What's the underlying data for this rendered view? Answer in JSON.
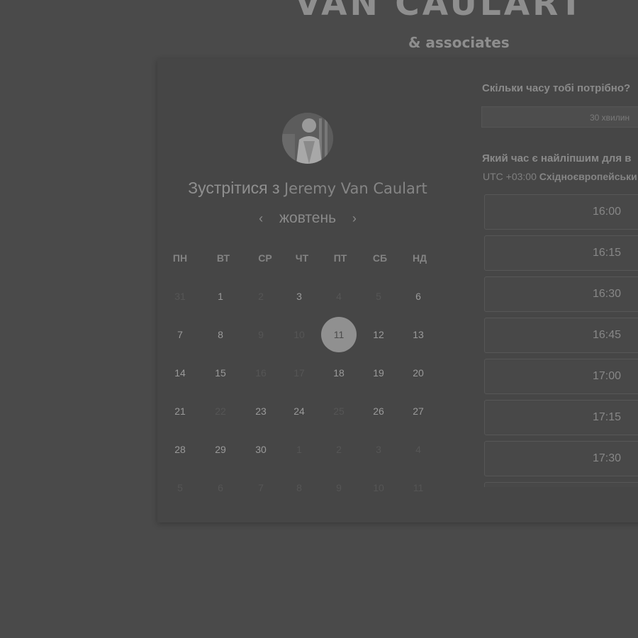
{
  "brand": {
    "name": "VAN CAULART",
    "subtitle": "& associates"
  },
  "host": {
    "avatar_icon": "person-avatar",
    "title_prefix": "Зустрітися з",
    "name": "Jeremy Van Caulart"
  },
  "calendar": {
    "month": "жовтень",
    "prev_icon": "chevron-left-icon",
    "next_icon": "chevron-right-icon",
    "weekdays": [
      "ПН",
      "ВТ",
      "СР",
      "ЧТ",
      "ПТ",
      "СБ",
      "НД"
    ],
    "selected_day": "11",
    "weeks": [
      [
        {
          "d": "31",
          "s": "muted"
        },
        {
          "d": "1",
          "s": "active"
        },
        {
          "d": "2",
          "s": "muted"
        },
        {
          "d": "3",
          "s": "active"
        },
        {
          "d": "4",
          "s": "muted"
        },
        {
          "d": "5",
          "s": "muted"
        },
        {
          "d": "6",
          "s": "active"
        }
      ],
      [
        {
          "d": "7",
          "s": "active"
        },
        {
          "d": "8",
          "s": "active"
        },
        {
          "d": "9",
          "s": "muted"
        },
        {
          "d": "10",
          "s": "muted"
        },
        {
          "d": "11",
          "s": "selected"
        },
        {
          "d": "12",
          "s": "active"
        },
        {
          "d": "13",
          "s": "active"
        }
      ],
      [
        {
          "d": "14",
          "s": "active"
        },
        {
          "d": "15",
          "s": "active"
        },
        {
          "d": "16",
          "s": "muted"
        },
        {
          "d": "17",
          "s": "muted"
        },
        {
          "d": "18",
          "s": "active"
        },
        {
          "d": "19",
          "s": "active"
        },
        {
          "d": "20",
          "s": "active"
        }
      ],
      [
        {
          "d": "21",
          "s": "active"
        },
        {
          "d": "22",
          "s": "muted"
        },
        {
          "d": "23",
          "s": "active"
        },
        {
          "d": "24",
          "s": "active"
        },
        {
          "d": "25",
          "s": "muted"
        },
        {
          "d": "26",
          "s": "active"
        },
        {
          "d": "27",
          "s": "active"
        }
      ],
      [
        {
          "d": "28",
          "s": "active"
        },
        {
          "d": "29",
          "s": "active"
        },
        {
          "d": "30",
          "s": "active"
        },
        {
          "d": "1",
          "s": "muted"
        },
        {
          "d": "2",
          "s": "muted"
        },
        {
          "d": "3",
          "s": "muted"
        },
        {
          "d": "4",
          "s": "muted"
        }
      ],
      [
        {
          "d": "5",
          "s": "muted"
        },
        {
          "d": "6",
          "s": "muted"
        },
        {
          "d": "7",
          "s": "muted"
        },
        {
          "d": "8",
          "s": "muted"
        },
        {
          "d": "9",
          "s": "muted"
        },
        {
          "d": "10",
          "s": "muted"
        },
        {
          "d": "11",
          "s": "muted"
        }
      ]
    ]
  },
  "duration": {
    "question": "Скільки часу тобі потрібно?",
    "selected": "30 хвилин"
  },
  "time": {
    "question": "Який час є найліпшим для в",
    "tz_offset": "UTC +03:00",
    "tz_name": "Східноєвропейськи",
    "slots": [
      "16:00",
      "16:15",
      "16:30",
      "16:45",
      "17:00",
      "17:15",
      "17:30",
      ""
    ]
  },
  "colors": {
    "background": "#4a4a4a",
    "card": "#464646",
    "selected_day": "#909090"
  }
}
